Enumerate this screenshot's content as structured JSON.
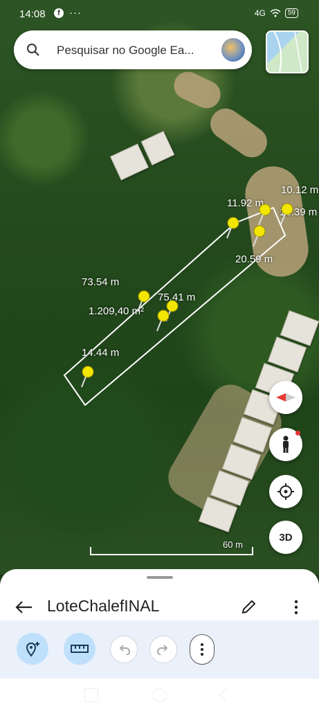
{
  "status": {
    "time": "14:08",
    "network": "4G",
    "battery": "59"
  },
  "search": {
    "placeholder": "Pesquisar no Google Ea..."
  },
  "measurements": {
    "top_left": "11.92 m",
    "top_right": "10.12 m",
    "right_mid": "13.39 m",
    "right_lower": "20.59 m",
    "left_side": "73.54 m",
    "center": "75.41 m",
    "area": "1.209,40 m²",
    "bottom": "14.44 m"
  },
  "scale": {
    "label": "60 m"
  },
  "buttons": {
    "three_d": "3D"
  },
  "sheet": {
    "project_title": "LoteChalefINAL"
  },
  "icons": {
    "search": "search-icon",
    "compass": "compass-icon",
    "street_view": "pegman-icon",
    "location": "my-location-icon",
    "back": "arrow-back-icon",
    "edit": "pencil-icon",
    "more": "more-vert-icon",
    "add_place": "add-placemark-icon",
    "measure": "ruler-icon",
    "undo": "undo-icon",
    "redo": "redo-icon"
  },
  "colors": {
    "accent": "#bfe0fb",
    "polygon": "#ffffff",
    "pin": "#f3e600"
  }
}
